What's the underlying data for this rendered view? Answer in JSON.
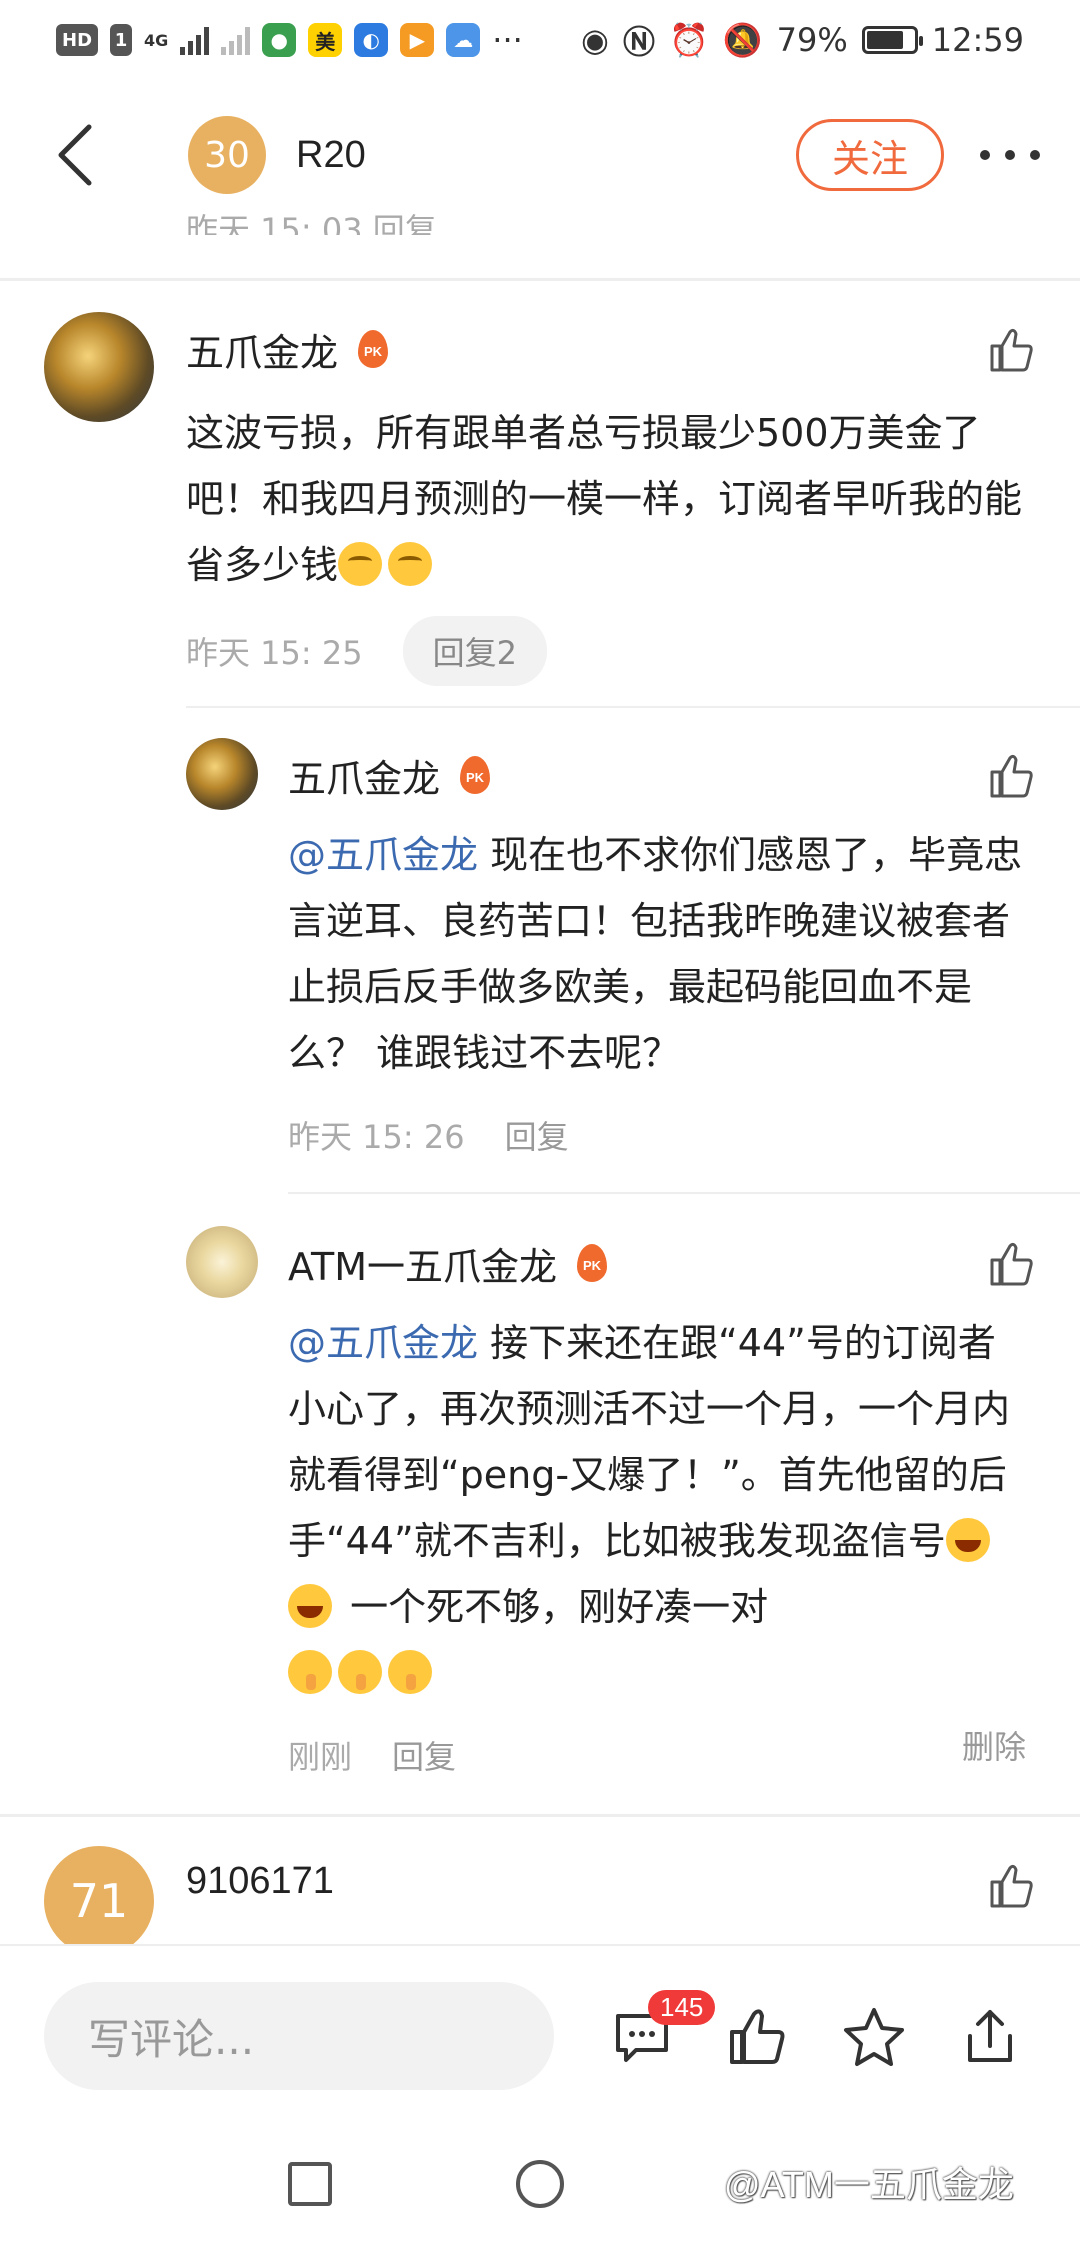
{
  "status_bar": {
    "hd_label": "HD",
    "sim1": "1",
    "network": "4G",
    "meituan": "美",
    "battery_percent": "79%",
    "battery_level": 0.79,
    "time": "12:59",
    "more": "···"
  },
  "header": {
    "level": "30",
    "title": "R20",
    "follow_label": "关注"
  },
  "comments": [
    {
      "user": "五爪金龙",
      "badge": "PK",
      "text_1": "这波亏损，所有跟单者总亏损最少500万美金了吧！和我四月预测的一模一样，订阅者早听我的能省多少钱",
      "time": "昨天 15: 25",
      "reply_label": "回复2"
    },
    {
      "user": "五爪金龙",
      "badge": "PK",
      "mention": "@五爪金龙",
      "text": " 现在也不求你们感恩了，毕竟忠言逆耳、良药苦口！包括我昨晚建议被套者止损后反手做多欧美，最起码能回血不是么？ 谁跟钱过不去呢？",
      "time": "昨天 15: 26",
      "reply_label": "回复"
    },
    {
      "user": "ATM一五爪金龙",
      "badge": "PK",
      "mention": "@五爪金龙",
      "text_1": " 接下来还在跟“44”号的订阅者小心了，再次预测活不过一个月，一个月内就看得到“peng-又爆了！”。首先他留的后手“44”就不吉利，比如被我发现盗信号",
      "text_2": " 一个死不够，刚好凑一对",
      "time": "刚刚",
      "reply_label": "回复",
      "delete_label": "删除"
    },
    {
      "user": "9106171",
      "avatar_text": "71"
    }
  ],
  "bottom_bar": {
    "input_placeholder": "写评论...",
    "comment_count": "145"
  },
  "watermark": "@ATM一五爪金龙",
  "colors": {
    "accent": "#f06a3e",
    "badge": "#e8b161",
    "mention": "#3c6ab0"
  }
}
